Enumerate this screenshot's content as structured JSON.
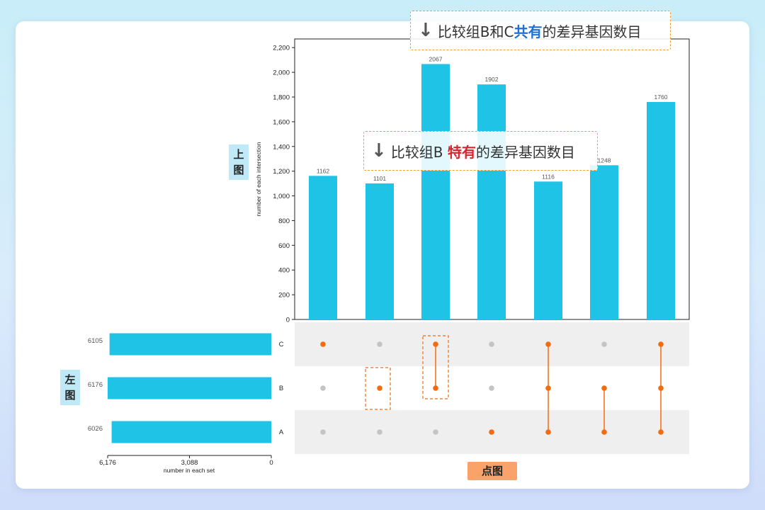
{
  "chart_data": {
    "type": "upset",
    "intersections": {
      "values": [
        1162,
        1101,
        2067,
        1902,
        1116,
        1248,
        1760
      ],
      "ylabel": "number of each intersection",
      "ylim": [
        0,
        2270
      ],
      "yticks": [
        0,
        200,
        400,
        600,
        800,
        1000,
        1200,
        1400,
        1600,
        1800,
        2000,
        2200
      ],
      "ytick_labels": [
        "0",
        "200",
        "400",
        "600",
        "800",
        "1,000",
        "1,200",
        "1,400",
        "1,600",
        "1,800",
        "2,000",
        "2,200"
      ]
    },
    "sets": {
      "names": [
        "C",
        "B",
        "A"
      ],
      "sizes": [
        6105,
        6176,
        6026
      ],
      "xlabel": "number in each set",
      "xticks": [
        6176,
        3088,
        0
      ],
      "xtick_labels": [
        "6,176",
        "3,088",
        "0"
      ]
    },
    "matrix": [
      [
        "C"
      ],
      [
        "B"
      ],
      [
        "C",
        "B"
      ],
      [
        "A"
      ],
      [
        "C",
        "B",
        "A"
      ],
      [
        "B",
        "A"
      ],
      [
        "C",
        "B",
        "A"
      ]
    ],
    "colors": {
      "bar": "#1ec3e6",
      "active_dot": "#f26b0f",
      "inactive_dot": "#c4c4c4",
      "band": "#efefef"
    }
  },
  "labels": {
    "top_chart": "上图",
    "left_chart": "左图",
    "dot_chart": "点图"
  },
  "callouts": {
    "shared": {
      "arrow": "↓",
      "pre": "比较组B和C",
      "hl": "共有",
      "post": "的差异基因数目"
    },
    "unique": {
      "arrow": "↓",
      "pre": "比较组B ",
      "hl": "特有",
      "post": "的差异基因数目"
    }
  }
}
